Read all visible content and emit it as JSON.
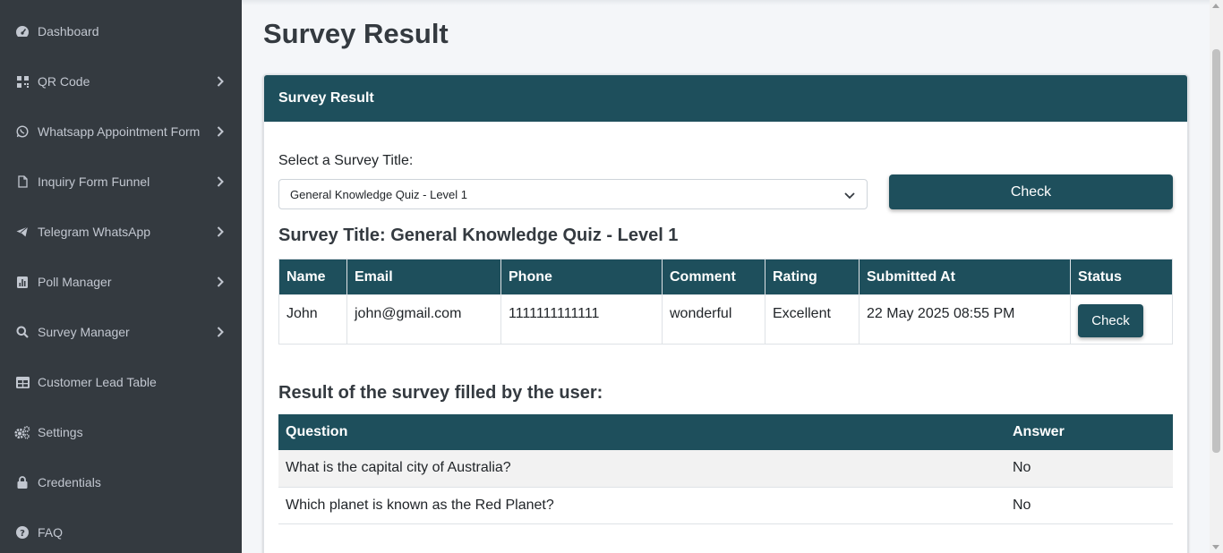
{
  "sidebar": {
    "items": [
      {
        "label": "Dashboard",
        "icon": "dashboard-icon",
        "has_submenu": false
      },
      {
        "label": "QR Code",
        "icon": "qrcode-icon",
        "has_submenu": true
      },
      {
        "label": "Whatsapp Appointment Form",
        "icon": "whatsapp-icon",
        "has_submenu": true
      },
      {
        "label": "Inquiry Form Funnel",
        "icon": "file-icon",
        "has_submenu": true
      },
      {
        "label": "Telegram WhatsApp",
        "icon": "telegram-icon",
        "has_submenu": true
      },
      {
        "label": "Poll Manager",
        "icon": "poll-icon",
        "has_submenu": true
      },
      {
        "label": "Survey Manager",
        "icon": "search-icon",
        "has_submenu": true
      },
      {
        "label": "Customer Lead Table",
        "icon": "table-icon",
        "has_submenu": false
      },
      {
        "label": "Settings",
        "icon": "gears-icon",
        "has_submenu": false
      },
      {
        "label": "Credentials",
        "icon": "lock-icon",
        "has_submenu": false
      },
      {
        "label": "FAQ",
        "icon": "question-icon",
        "has_submenu": false
      }
    ]
  },
  "page": {
    "title": "Survey Result"
  },
  "card": {
    "header": "Survey Result",
    "select_label": "Select a Survey Title:",
    "select_value": "General Knowledge Quiz - Level 1",
    "check_button": "Check",
    "survey_title": "Survey Title: General Knowledge Quiz - Level 1",
    "submissions": {
      "columns": [
        "Name",
        "Email",
        "Phone",
        "Comment",
        "Rating",
        "Submitted At",
        "Status"
      ],
      "rows": [
        {
          "name": "John",
          "email": "john@gmail.com",
          "phone": "1111111111111",
          "comment": "wonderful",
          "rating": "Excellent",
          "submitted_at": "22 May 2025 08:55 PM",
          "status_button": "Check"
        }
      ]
    },
    "result_heading": "Result of the survey filled by the user:",
    "answers": {
      "columns": [
        "Question",
        "Answer"
      ],
      "rows": [
        {
          "question": "What is the capital city of Australia?",
          "answer": "No"
        },
        {
          "question": "Which planet is known as the Red Planet?",
          "answer": "No"
        }
      ]
    }
  },
  "colors": {
    "sidebar_bg": "#343a40",
    "sidebar_text": "#c2c7d0",
    "accent": "#1e4f5c",
    "page_bg": "#f4f6f9"
  }
}
